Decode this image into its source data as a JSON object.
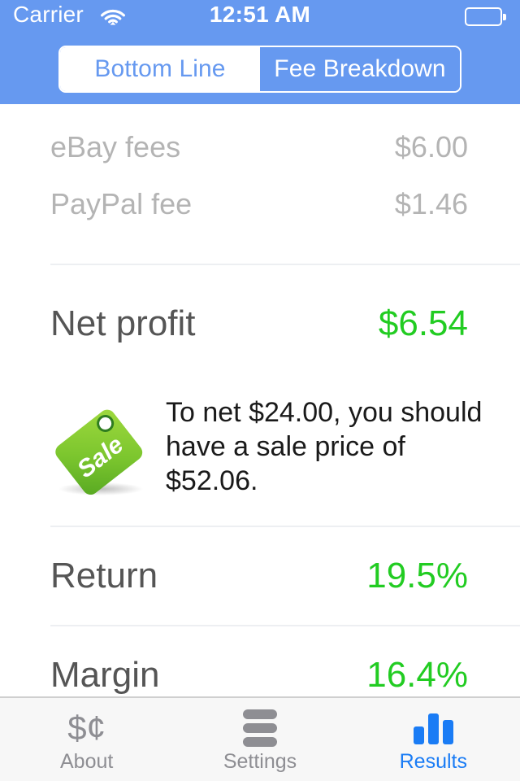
{
  "status_bar": {
    "carrier": "Carrier",
    "time": "12:51 AM",
    "wifi_icon": "wifi-icon",
    "battery_icon": "battery-icon"
  },
  "segmented_control": {
    "options": [
      {
        "label": "Bottom Line",
        "selected": false
      },
      {
        "label": "Fee Breakdown",
        "selected": true
      }
    ]
  },
  "results": {
    "clipped_row": {
      "label": "",
      "value": ""
    },
    "fees": [
      {
        "label": "eBay fees",
        "value": "$6.00"
      },
      {
        "label": "PayPal fee",
        "value": "$1.46"
      }
    ],
    "net_profit": {
      "label": "Net profit",
      "value": "$6.54"
    },
    "suggestion": {
      "icon": "sale-tag-icon",
      "icon_text": "Sale",
      "text": "To net $24.00, you should have a sale price of $52.06."
    },
    "metrics": [
      {
        "label": "Return",
        "value": "19.5%"
      },
      {
        "label": "Margin",
        "value": "16.4%"
      }
    ]
  },
  "tab_bar": {
    "tabs": [
      {
        "label": "About",
        "icon": "dollar-cent-icon",
        "active": false
      },
      {
        "label": "Settings",
        "icon": "sliders-stack-icon",
        "active": false
      },
      {
        "label": "Results",
        "icon": "bar-chart-icon",
        "active": true
      }
    ]
  },
  "colors": {
    "nav_blue": "#6699f0",
    "accent_green": "#22cc22",
    "tab_active_blue": "#1a7cf5",
    "muted_gray": "#b4b4b4",
    "label_gray": "#555555"
  }
}
